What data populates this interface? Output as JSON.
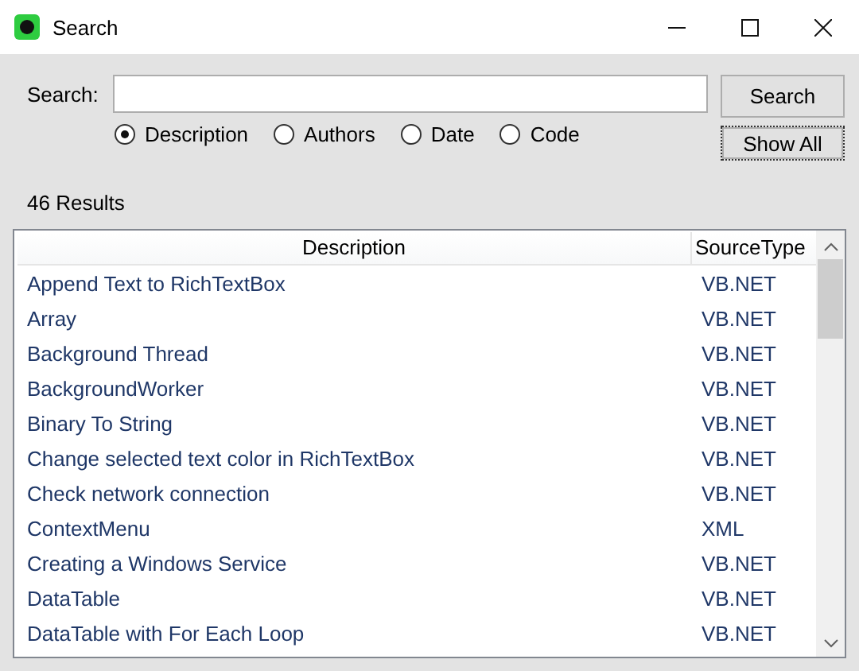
{
  "window": {
    "title": "Search"
  },
  "search": {
    "label": "Search:"
  },
  "buttons": [
    {
      "label": "Search",
      "focused": false
    },
    {
      "label": "Show All",
      "focused": true
    }
  ],
  "filters": [
    {
      "label": "Description",
      "selected": true
    },
    {
      "label": "Authors",
      "selected": false
    },
    {
      "label": "Date",
      "selected": false
    },
    {
      "label": "Code",
      "selected": false
    }
  ],
  "result_count": "46 Results",
  "table": {
    "columns": [
      "Description",
      "SourceType"
    ],
    "rows": [
      {
        "description": "Append Text to RichTextBox",
        "source_type": "VB.NET"
      },
      {
        "description": "Array",
        "source_type": "VB.NET"
      },
      {
        "description": "Background Thread",
        "source_type": "VB.NET"
      },
      {
        "description": "BackgroundWorker",
        "source_type": "VB.NET"
      },
      {
        "description": "Binary To String",
        "source_type": "VB.NET"
      },
      {
        "description": "Change selected text color in RichTextBox",
        "source_type": "VB.NET"
      },
      {
        "description": "Check network connection",
        "source_type": "VB.NET"
      },
      {
        "description": "ContextMenu",
        "source_type": "XML"
      },
      {
        "description": "Creating a Windows Service",
        "source_type": "VB.NET"
      },
      {
        "description": "DataTable",
        "source_type": "VB.NET"
      },
      {
        "description": "DataTable with For Each Loop",
        "source_type": "VB.NET"
      }
    ]
  }
}
